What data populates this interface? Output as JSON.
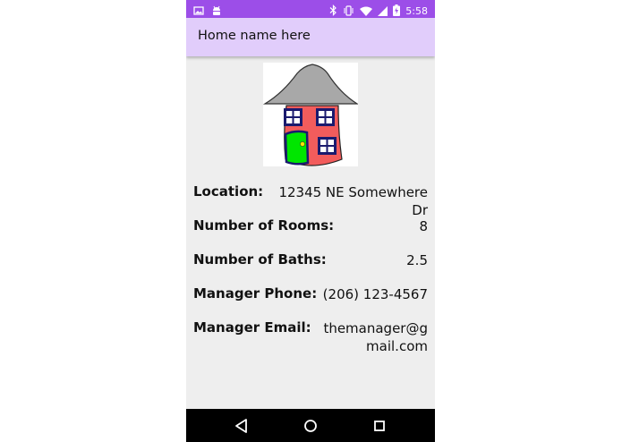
{
  "status_bar": {
    "time": "5:58",
    "left_icons": [
      "image-icon",
      "android-icon"
    ],
    "right_icons": [
      "bluetooth-icon",
      "vibrate-icon",
      "wifi-icon",
      "signal-icon",
      "battery-charging-icon"
    ]
  },
  "app_bar": {
    "title": "Home name here"
  },
  "home_image": {
    "icon": "house-icon"
  },
  "details": [
    {
      "label": "Location:",
      "value": "12345 NE Somewhere\nDr"
    },
    {
      "label": "Number of Rooms:",
      "value": "8"
    },
    {
      "label": "Number of Baths:",
      "value": "2.5"
    },
    {
      "label": "Manager Phone:",
      "value": "(206) 123-4567"
    },
    {
      "label": "Manager Email:",
      "value": "themanager@g\nmail.com"
    }
  ],
  "nav_bar": {
    "buttons": [
      "back-icon",
      "home-icon",
      "recents-icon"
    ]
  },
  "colors": {
    "status_bar": "#9c4ee8",
    "app_bar": "#e1cdfb",
    "background": "#eeeeee",
    "house_walls": "#f25c5c",
    "house_roof": "#a8a8a8",
    "door": "#00e600",
    "windows": "#1a1a6e"
  }
}
